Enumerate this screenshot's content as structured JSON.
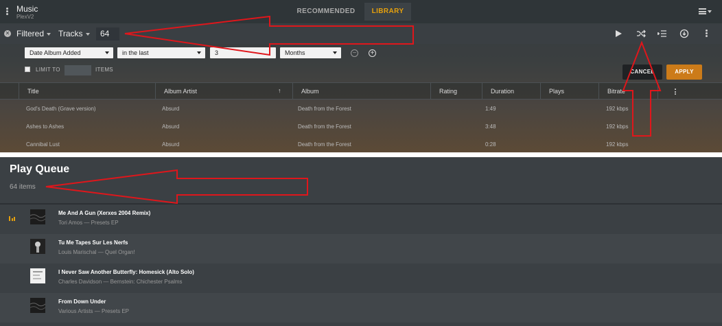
{
  "app": {
    "title": "Music",
    "subtitle": "PlexV2"
  },
  "tabs": {
    "recommended": "RECOMMENDED",
    "library": "LIBRARY"
  },
  "filterbar": {
    "filtered": "Filtered",
    "tracks": "Tracks",
    "count": "64"
  },
  "filter": {
    "field": "Date Album Added",
    "operator": "in the last",
    "value": "3",
    "unit": "Months",
    "limit_label": "LIMIT TO",
    "items_label": "ITEMS",
    "cancel": "CANCEL",
    "apply": "APPLY"
  },
  "columns": {
    "title": "Title",
    "album_artist": "Album Artist",
    "album": "Album",
    "rating": "Rating",
    "duration": "Duration",
    "plays": "Plays",
    "bitrate": "Bitrate"
  },
  "rows": [
    {
      "title": "God's Death (Grave version)",
      "artist": "Absurd",
      "album": "Death from the Forest",
      "duration": "1:49",
      "bitrate": "192 kbps"
    },
    {
      "title": "Ashes to Ashes",
      "artist": "Absurd",
      "album": "Death from the Forest",
      "duration": "3:48",
      "bitrate": "192 kbps"
    },
    {
      "title": "Cannibal Lust",
      "artist": "Absurd",
      "album": "Death from the Forest",
      "duration": "0:28",
      "bitrate": "192 kbps"
    }
  ],
  "queue": {
    "title": "Play Queue",
    "count": "64 items",
    "items": [
      {
        "title": "Me And A Gun (Xerxes 2004 Remix)",
        "subtitle": "Tori Amos — Presets EP"
      },
      {
        "title": "Tu Me Tapes Sur Les Nerfs",
        "subtitle": "Louis Marischal — Quel Organ!"
      },
      {
        "title": "I Never Saw Another Butterfly: Homesick (Alto Solo)",
        "subtitle": "Charles Davidson — Bernstein: Chichester Psalms"
      },
      {
        "title": "From Down Under",
        "subtitle": "Various Artists — Presets EP"
      }
    ]
  },
  "colors": {
    "accent": "#e5a00d",
    "apply": "#cc7b19",
    "annotation": "#e0161b"
  }
}
